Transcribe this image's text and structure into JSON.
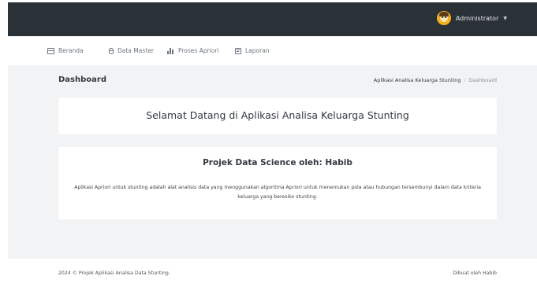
{
  "colors": {
    "topbar_bg": "#2a3137",
    "content_bg": "#f1f3f5",
    "card_bg": "#ffffff",
    "text_dark": "#33393f",
    "nav_text": "#6c757d"
  },
  "topbar": {
    "user_name": "Administrator",
    "avatar_icon": "user-avatar-icon",
    "caret_icon": "chevron-down-icon"
  },
  "nav": {
    "items": [
      {
        "label": "Beranda",
        "icon": "home-icon"
      },
      {
        "label": "Data Master",
        "icon": "database-icon"
      },
      {
        "label": "Proses Apriori",
        "icon": "bar-chart-icon"
      },
      {
        "label": "Laporan",
        "icon": "report-icon"
      }
    ]
  },
  "page": {
    "title": "Dashboard",
    "breadcrumb": {
      "root": "Aplikasi Analisa Keluarga Stunting",
      "separator": "/",
      "current": "Dashboard"
    }
  },
  "welcome_card": {
    "title": "Selamat Datang di Aplikasi Analisa Keluarga Stunting"
  },
  "project_card": {
    "heading": "Projek Data Science oleh: Habib",
    "description": "Aplikasi Apriori untuk stunting adalah alat analisis data yang menggunakan algoritma Apriori untuk menemukan pola atau hubungan tersembunyi dalam data kriteria keluarga yang beresiko stunting."
  },
  "footer": {
    "left": "2024 © Projek Aplikasi Analisa Data Stunting.",
    "right": "Dibuat oleh Habib"
  }
}
